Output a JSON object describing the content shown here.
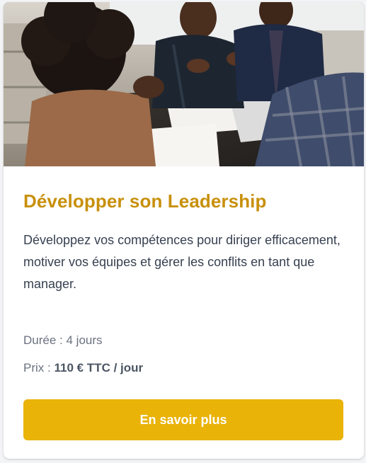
{
  "card": {
    "image_description_icon": "team-meeting-photo",
    "title": "Développer son Leadership",
    "description": "Développez vos compétences pour diriger efficacement, motiver vos équipes et gérer les conflits en tant que manager.",
    "duration": {
      "label": "Durée :",
      "value": "4 jours"
    },
    "price": {
      "label": "Prix :",
      "value": "110 € TTC / jour"
    },
    "cta_label": "En savoir plus"
  },
  "colors": {
    "title": "#c8900b",
    "button": "#eab308",
    "text": "#374151",
    "muted": "#6b7280"
  }
}
